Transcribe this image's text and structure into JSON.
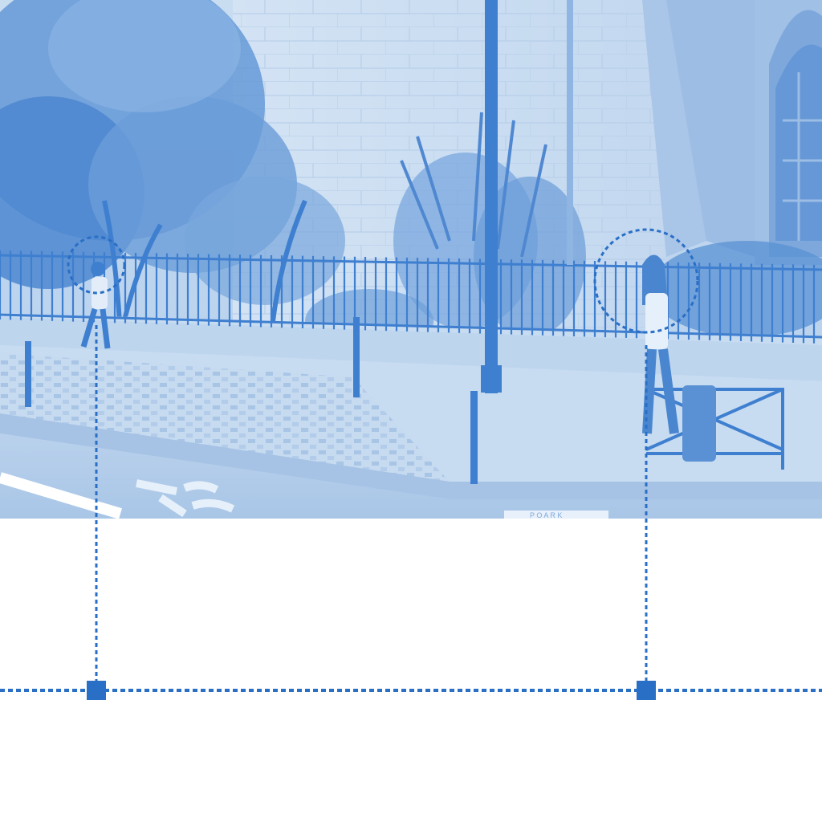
{
  "colors": {
    "accent": "#2a6fc6",
    "tint_dark": "#3f7fd0",
    "tint_mid": "#8fb6e3",
    "tint_light": "#d6e6f6",
    "background": "#ffffff"
  },
  "photo": {
    "subject": "street-corner",
    "tint": "monochrome-blue",
    "sign_text": "P O A R K"
  },
  "markers": [
    {
      "id": "person-left"
    },
    {
      "id": "person-right"
    }
  ]
}
